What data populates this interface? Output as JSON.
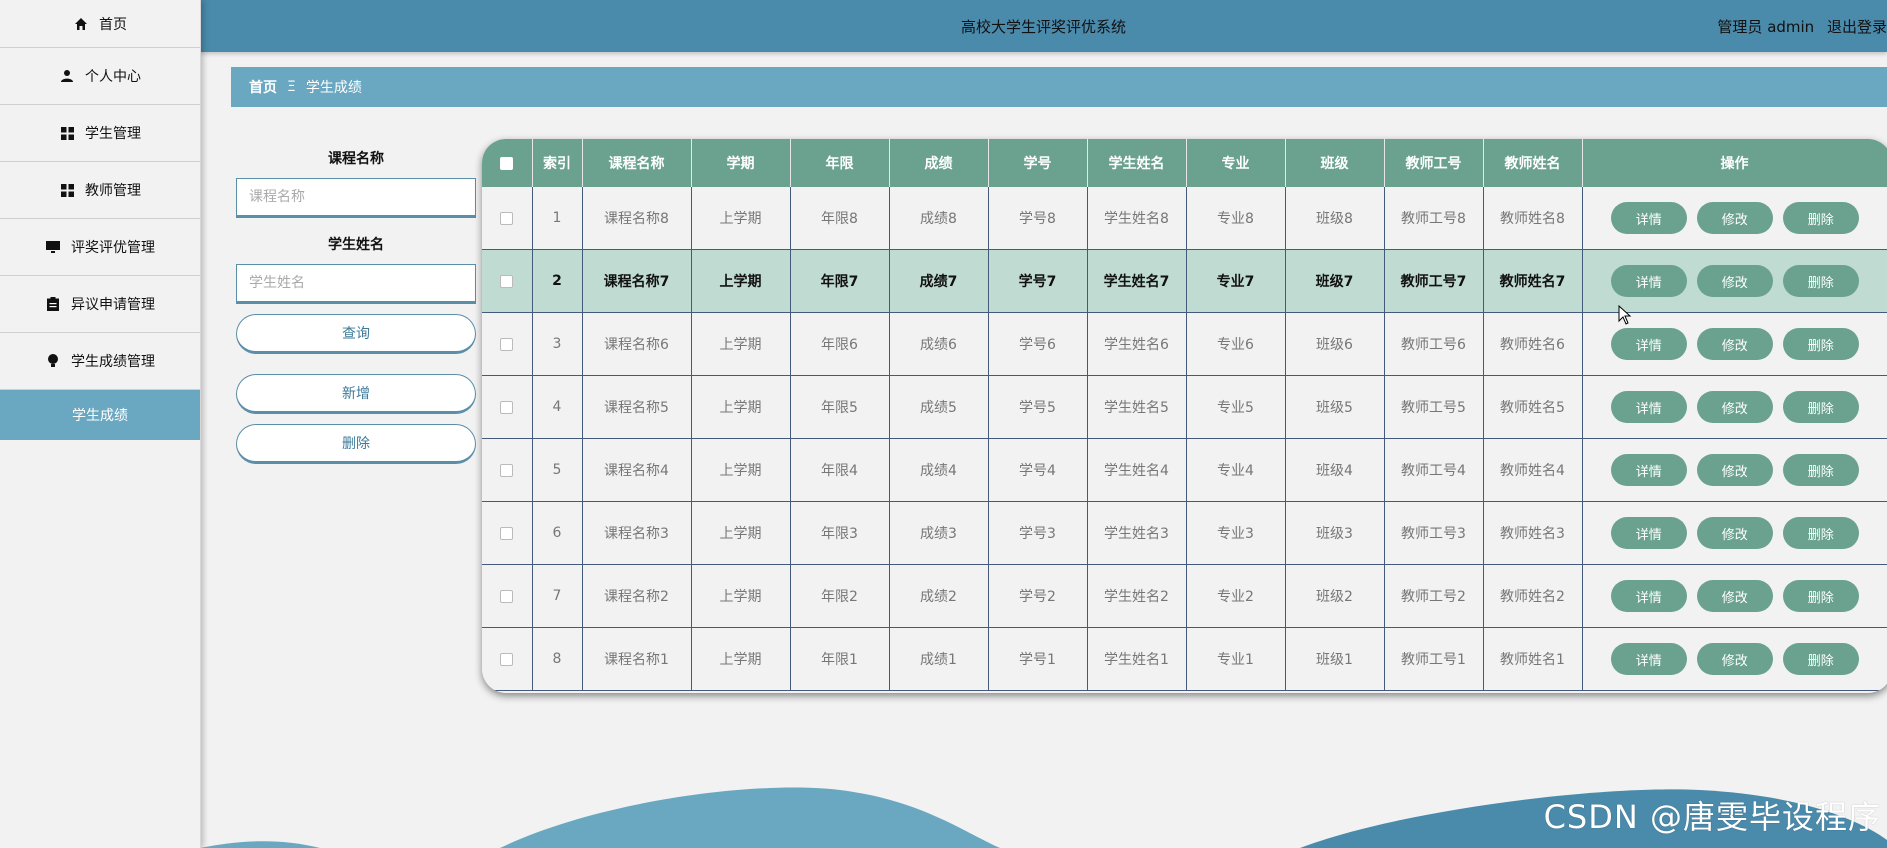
{
  "header": {
    "title": "高校大学生评奖评优系统",
    "user_label": "管理员 admin",
    "logout": "退出登录"
  },
  "sidebar": {
    "items": [
      {
        "label": "首页",
        "icon": "home-icon"
      },
      {
        "label": "个人中心",
        "icon": "user-icon"
      },
      {
        "label": "学生管理",
        "icon": "grid-icon"
      },
      {
        "label": "教师管理",
        "icon": "grid-icon"
      },
      {
        "label": "评奖评优管理",
        "icon": "monitor-icon"
      },
      {
        "label": "异议申请管理",
        "icon": "clipboard-icon"
      },
      {
        "label": "学生成绩管理",
        "icon": "bulb-icon"
      }
    ],
    "sub_item": "学生成绩"
  },
  "breadcrumb": {
    "home": "首页",
    "separator": "Ξ",
    "current": "学生成绩"
  },
  "search": {
    "course_label": "课程名称",
    "course_placeholder": "课程名称",
    "student_label": "学生姓名",
    "student_placeholder": "学生姓名",
    "query_button": "查询",
    "add_button": "新增",
    "delete_button": "删除"
  },
  "table": {
    "columns": [
      "索引",
      "课程名称",
      "学期",
      "年限",
      "成绩",
      "学号",
      "学生姓名",
      "专业",
      "班级",
      "教师工号",
      "教师姓名",
      "操作"
    ],
    "actions": {
      "detail": "详情",
      "edit": "修改",
      "delete": "删除"
    },
    "rows": [
      {
        "index": "1",
        "course": "课程名称8",
        "term": "上学期",
        "year": "年限8",
        "score": "成绩8",
        "sid": "学号8",
        "sname": "学生姓名8",
        "major": "专业8",
        "cls": "班级8",
        "tid": "教师工号8",
        "tname": "教师姓名8"
      },
      {
        "index": "2",
        "course": "课程名称7",
        "term": "上学期",
        "year": "年限7",
        "score": "成绩7",
        "sid": "学号7",
        "sname": "学生姓名7",
        "major": "专业7",
        "cls": "班级7",
        "tid": "教师工号7",
        "tname": "教师姓名7"
      },
      {
        "index": "3",
        "course": "课程名称6",
        "term": "上学期",
        "year": "年限6",
        "score": "成绩6",
        "sid": "学号6",
        "sname": "学生姓名6",
        "major": "专业6",
        "cls": "班级6",
        "tid": "教师工号6",
        "tname": "教师姓名6"
      },
      {
        "index": "4",
        "course": "课程名称5",
        "term": "上学期",
        "year": "年限5",
        "score": "成绩5",
        "sid": "学号5",
        "sname": "学生姓名5",
        "major": "专业5",
        "cls": "班级5",
        "tid": "教师工号5",
        "tname": "教师姓名5"
      },
      {
        "index": "5",
        "course": "课程名称4",
        "term": "上学期",
        "year": "年限4",
        "score": "成绩4",
        "sid": "学号4",
        "sname": "学生姓名4",
        "major": "专业4",
        "cls": "班级4",
        "tid": "教师工号4",
        "tname": "教师姓名4"
      },
      {
        "index": "6",
        "course": "课程名称3",
        "term": "上学期",
        "year": "年限3",
        "score": "成绩3",
        "sid": "学号3",
        "sname": "学生姓名3",
        "major": "专业3",
        "cls": "班级3",
        "tid": "教师工号3",
        "tname": "教师姓名3"
      },
      {
        "index": "7",
        "course": "课程名称2",
        "term": "上学期",
        "year": "年限2",
        "score": "成绩2",
        "sid": "学号2",
        "sname": "学生姓名2",
        "major": "专业2",
        "cls": "班级2",
        "tid": "教师工号2",
        "tname": "教师姓名2"
      },
      {
        "index": "8",
        "course": "课程名称1",
        "term": "上学期",
        "year": "年限1",
        "score": "成绩1",
        "sid": "学号1",
        "sname": "学生姓名1",
        "major": "专业1",
        "cls": "班级1",
        "tid": "教师工号1",
        "tname": "教师姓名1"
      }
    ],
    "highlighted_row": 1
  },
  "watermark": "CSDN @唐雯毕设程序",
  "colors": {
    "header": "#4a8aab",
    "accent": "#6aa8c2",
    "table_header": "#6aa28f",
    "row_highlight": "#c0dbd2"
  }
}
